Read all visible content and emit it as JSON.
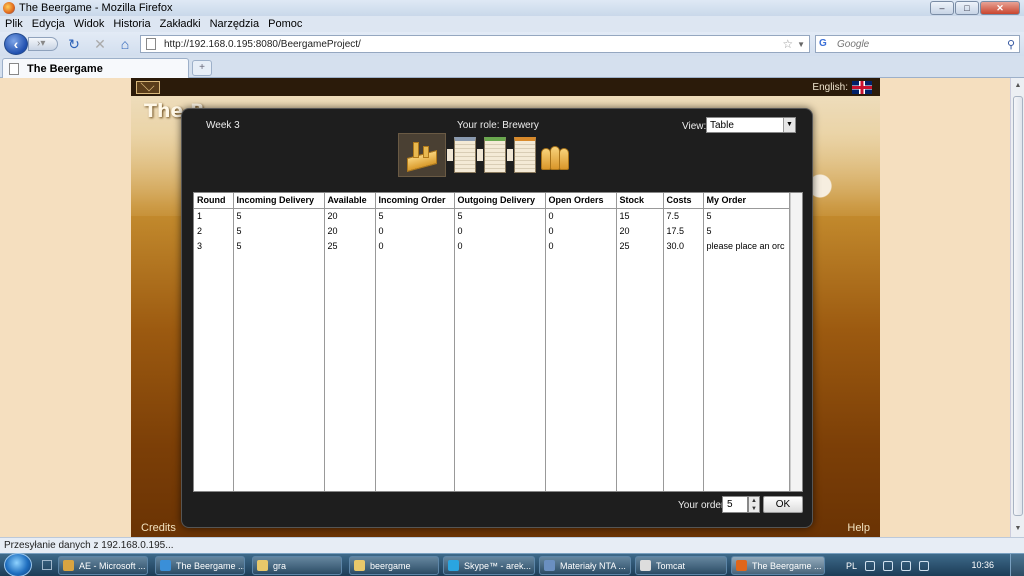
{
  "window": {
    "title": "The Beergame - Mozilla Firefox",
    "minimize": "–",
    "maximize": "□",
    "close": "✕"
  },
  "menu": [
    "Plik",
    "Edycja",
    "Widok",
    "Historia",
    "Zakładki",
    "Narzędzia",
    "Pomoc"
  ],
  "nav": {
    "url": "http://192.168.0.195:8080/BeergameProject/",
    "search_placeholder": "Google",
    "search_engine": "G"
  },
  "tab": {
    "title": "The Beergame",
    "new_tab": "+"
  },
  "page": {
    "brand": "The B",
    "language": "English:",
    "credits": "Credits",
    "help": "Help"
  },
  "dialog": {
    "week": "Week 3",
    "role": "Your role: Brewery",
    "view_label": "View:",
    "view_selected": "Table",
    "order_label": "Your order:",
    "order_value": "5",
    "ok_label": "OK"
  },
  "table": {
    "columns": [
      "Round",
      "Incoming Delivery",
      "Available",
      "Incoming Order",
      "Outgoing Delivery",
      "Open Orders",
      "Stock",
      "Costs",
      "My Order"
    ],
    "rows": [
      [
        "1",
        "5",
        "20",
        "5",
        "5",
        "0",
        "15",
        "7.5",
        "5"
      ],
      [
        "2",
        "5",
        "20",
        "0",
        "0",
        "0",
        "20",
        "17.5",
        "5"
      ],
      [
        "3",
        "5",
        "25",
        "0",
        "0",
        "0",
        "25",
        "30.0",
        "please place an orc"
      ]
    ]
  },
  "status": "Przesyłanie danych z 192.168.0.195...",
  "taskbar": {
    "items": [
      {
        "label": "AE - Microsoft ...",
        "color": "#d9a441"
      },
      {
        "label": "The Beergame ...",
        "color": "#3a8fd8"
      },
      {
        "label": "gra",
        "color": "#e8c86a"
      },
      {
        "label": "beergame",
        "color": "#e8c86a"
      },
      {
        "label": "Skype™ - arek...",
        "color": "#2aa5e0"
      },
      {
        "label": "Materiały NTA ...",
        "color": "#6a8fc0"
      },
      {
        "label": "Tomcat",
        "color": "#dddddd"
      },
      {
        "label": "The Beergame ...",
        "color": "#e0661b"
      }
    ],
    "lang": "PL",
    "clock": "10:36"
  }
}
